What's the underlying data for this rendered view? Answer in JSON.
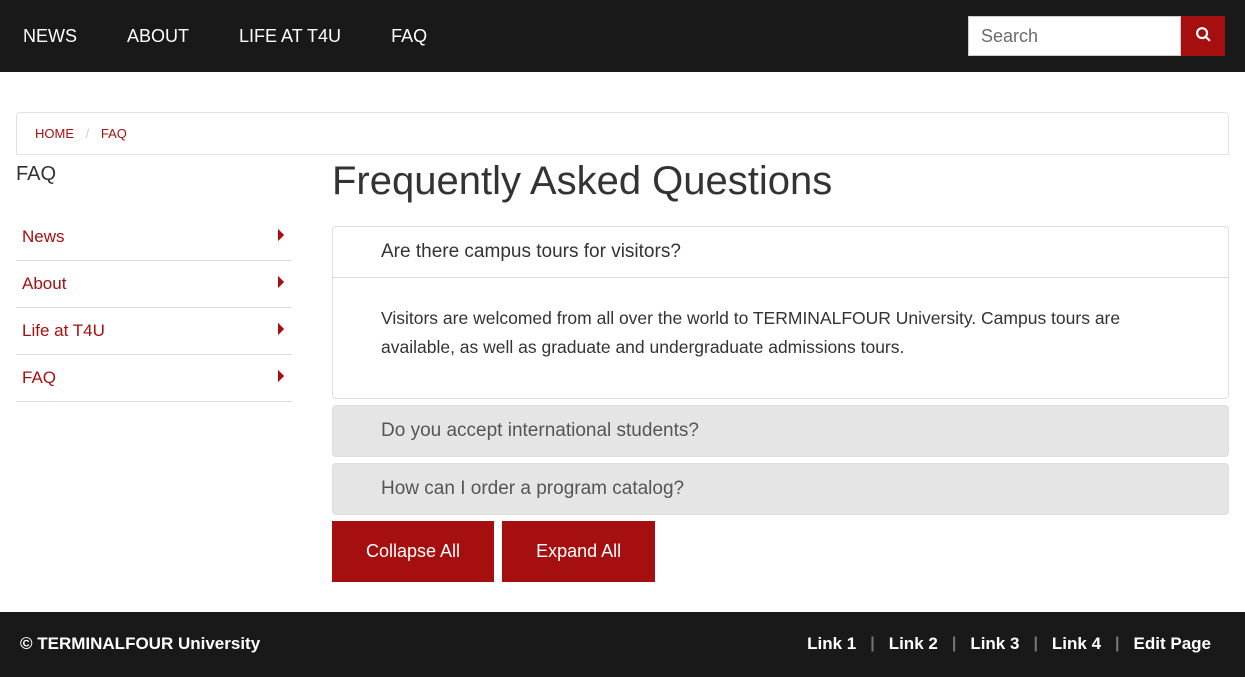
{
  "topnav": {
    "items": [
      {
        "label": "NEWS"
      },
      {
        "label": "ABOUT"
      },
      {
        "label": "LIFE AT T4U"
      },
      {
        "label": "FAQ"
      }
    ]
  },
  "search": {
    "placeholder": "Search"
  },
  "breadcrumb": {
    "home": "HOME",
    "sep": "/",
    "current": "FAQ"
  },
  "sidebar": {
    "title": "FAQ",
    "items": [
      {
        "label": "News"
      },
      {
        "label": "About"
      },
      {
        "label": "Life at T4U"
      },
      {
        "label": "FAQ"
      }
    ]
  },
  "main": {
    "title": "Frequently Asked Questions",
    "accordions": [
      {
        "question": "Are there campus tours for visitors?",
        "answer": "Visitors are welcomed from all over the world to TERMINALFOUR University. Campus tours are available, as well as graduate and undergraduate admissions tours.",
        "open": true
      },
      {
        "question": "Do you accept international students?",
        "open": false
      },
      {
        "question": "How can I order a program catalog?",
        "open": false
      }
    ],
    "collapse_label": "Collapse All",
    "expand_label": "Expand All"
  },
  "footer": {
    "copy": "© TERMINALFOUR University",
    "links": [
      {
        "label": "Link 1"
      },
      {
        "label": "Link 2"
      },
      {
        "label": "Link 3"
      },
      {
        "label": "Link 4"
      },
      {
        "label": "Edit Page"
      }
    ]
  }
}
